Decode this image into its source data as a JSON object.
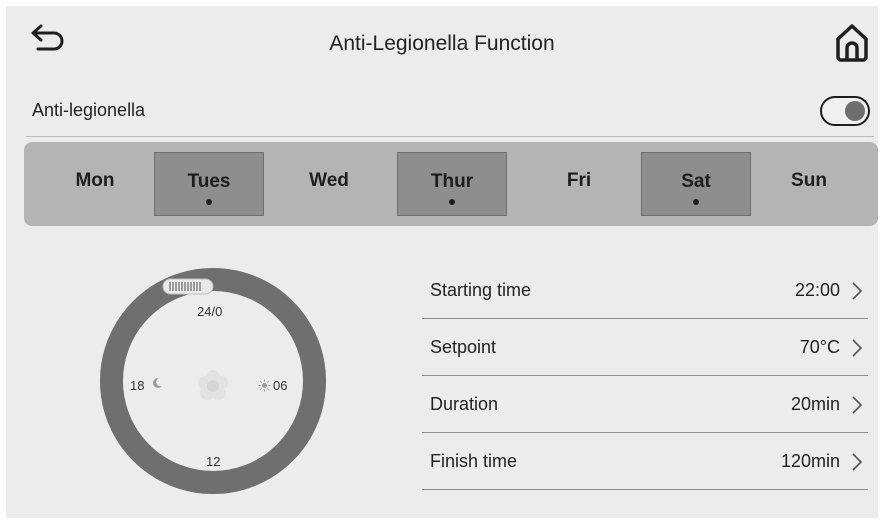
{
  "header": {
    "title": "Anti-Legionella Function",
    "back_icon": "back-arrow-icon",
    "home_icon": "home-icon"
  },
  "toggle": {
    "label": "Anti-legionella",
    "state": "on"
  },
  "days": [
    {
      "label": "Mon",
      "selected": false
    },
    {
      "label": "Tues",
      "selected": true
    },
    {
      "label": "Wed",
      "selected": false
    },
    {
      "label": "Thur",
      "selected": true
    },
    {
      "label": "Fri",
      "selected": false
    },
    {
      "label": "Sat",
      "selected": true
    },
    {
      "label": "Sun",
      "selected": false
    }
  ],
  "dial": {
    "top": "24/0",
    "right": "06",
    "bottom": "12",
    "left": "18"
  },
  "settings": [
    {
      "name": "Starting time",
      "value": "22:00"
    },
    {
      "name": "Setpoint",
      "value": "70°C"
    },
    {
      "name": "Duration",
      "value": "20min"
    },
    {
      "name": "Finish time",
      "value": "120min"
    }
  ],
  "colors": {
    "panel": "#ececec",
    "day_bar": "#b4b4b4",
    "day_selected": "#8e8e8e",
    "dial_ring": "#6f6f6f"
  }
}
